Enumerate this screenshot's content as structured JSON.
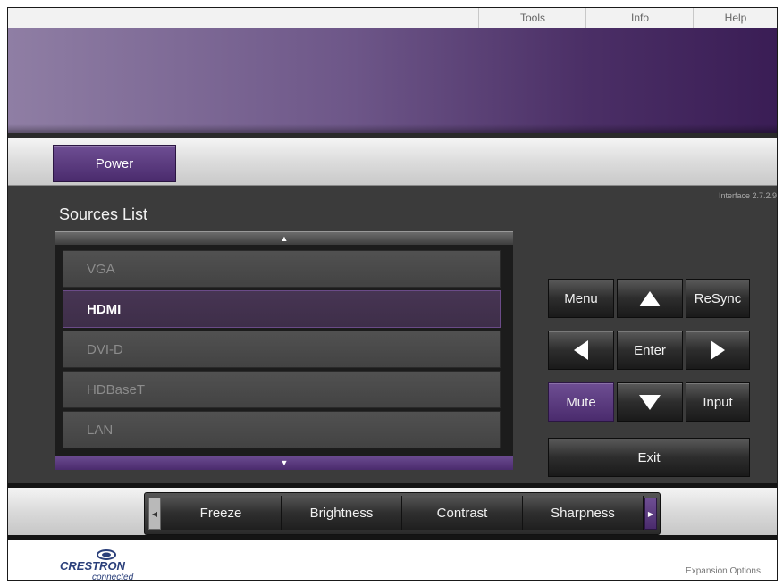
{
  "top_menu": {
    "tools": "Tools",
    "info": "Info",
    "help": "Help"
  },
  "power": {
    "label": "Power"
  },
  "version": "Interface 2.7.2.9",
  "sources": {
    "title": "Sources List",
    "up_arrow": "▲",
    "down_arrow": "▼",
    "items": [
      {
        "label": "VGA",
        "selected": false
      },
      {
        "label": "HDMI",
        "selected": true
      },
      {
        "label": "DVI-D",
        "selected": false
      },
      {
        "label": "HDBaseT",
        "selected": false
      },
      {
        "label": "LAN",
        "selected": false
      }
    ]
  },
  "controls": {
    "menu": "Menu",
    "resync": "ReSync",
    "enter": "Enter",
    "mute": "Mute",
    "input": "Input",
    "exit": "Exit"
  },
  "adjust": {
    "left_arrow": "◀",
    "right_arrow": "▶",
    "items": [
      "Freeze",
      "Brightness",
      "Contrast",
      "Sharpness"
    ]
  },
  "footer": {
    "logo_text": "CRESTRON",
    "logo_sub": "connected",
    "expansion": "Expansion Options"
  },
  "colors": {
    "accent_purple": "#4a2b6d",
    "panel_dark": "#3b3b3b",
    "selected_item": "#473553"
  },
  "icons": {
    "nav_up": "triangle-up",
    "nav_down": "triangle-down",
    "nav_left": "triangle-left",
    "nav_right": "triangle-right"
  }
}
